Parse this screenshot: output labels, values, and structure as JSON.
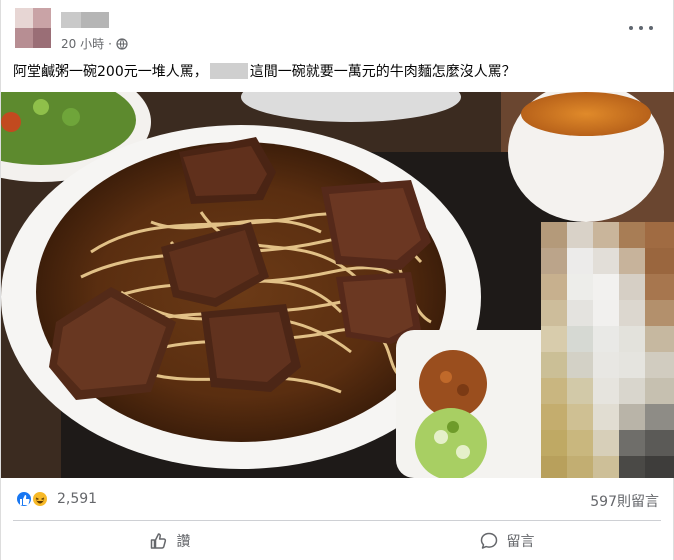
{
  "post": {
    "timestamp": "20 小時",
    "separator": "·",
    "text_before": "阿堂鹹粥一碗200元一堆人罵，",
    "text_after": "這間一碗就要一萬元的牛肉麵怎麼沒人罵？"
  },
  "reactions": {
    "count": "2,591",
    "types": [
      "like-icon",
      "haha-icon"
    ]
  },
  "comments": {
    "count_label": "597則留言"
  },
  "actions": {
    "like_label": "讚",
    "comment_label": "留言"
  },
  "colors": {
    "brand_blue": "#1877f2",
    "meta_gray": "#65676b",
    "haha_yellow": "#f7b928"
  }
}
